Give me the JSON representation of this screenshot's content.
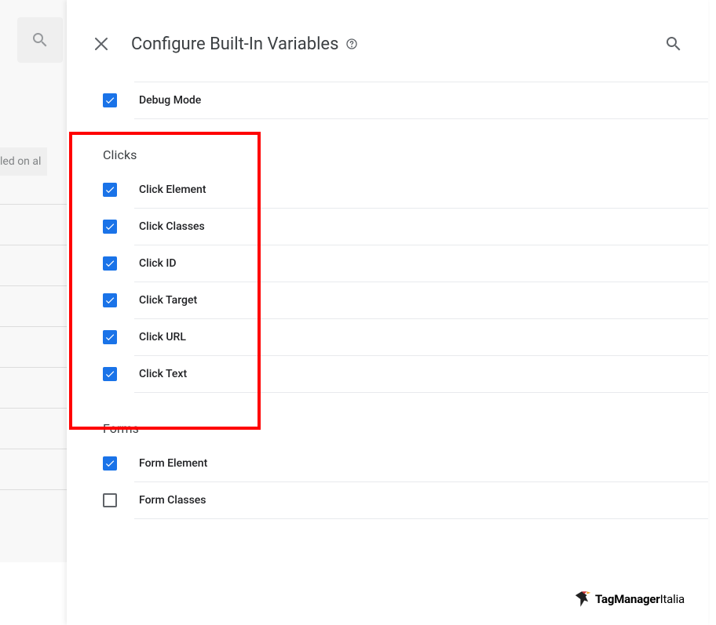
{
  "header": {
    "title": "Configure Built-In Variables"
  },
  "backdrop": {
    "partial_text": "led on al"
  },
  "preamble": {
    "items": [
      {
        "label": "Debug Mode",
        "checked": true
      }
    ]
  },
  "sections": [
    {
      "title": "Clicks",
      "highlighted": true,
      "items": [
        {
          "label": "Click Element",
          "checked": true
        },
        {
          "label": "Click Classes",
          "checked": true
        },
        {
          "label": "Click ID",
          "checked": true
        },
        {
          "label": "Click Target",
          "checked": true
        },
        {
          "label": "Click URL",
          "checked": true
        },
        {
          "label": "Click Text",
          "checked": true
        }
      ]
    },
    {
      "title": "Forms",
      "highlighted": false,
      "items": [
        {
          "label": "Form Element",
          "checked": true
        },
        {
          "label": "Form Classes",
          "checked": false
        }
      ]
    }
  ],
  "watermark": {
    "brand": "TagManager",
    "suffix": "Italia"
  }
}
